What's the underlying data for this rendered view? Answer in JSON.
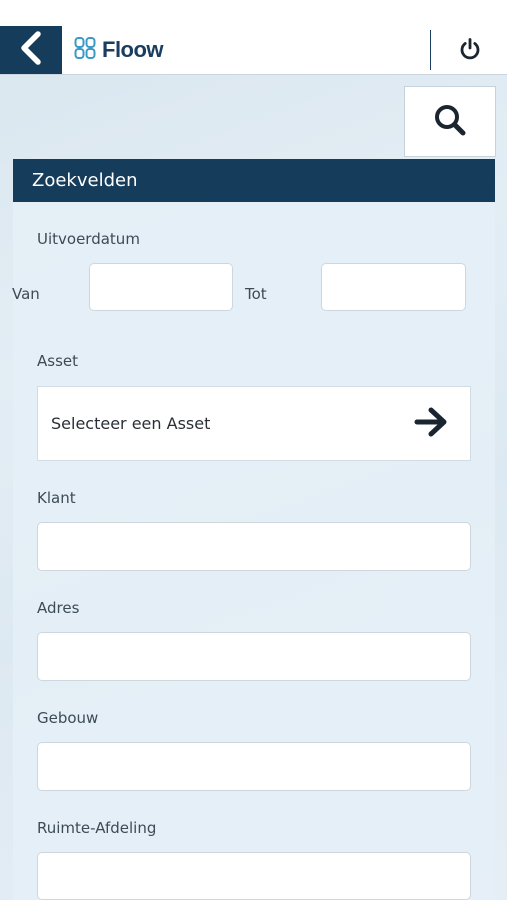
{
  "header": {
    "back_icon": "chevron-left-icon",
    "logo_text": "Floow",
    "power_icon": "power-icon",
    "brand_color": "#163c5c"
  },
  "search_button": {
    "icon": "search-icon"
  },
  "panel": {
    "title": "Zoekvelden",
    "uitvoerdatum_label": "Uitvoerdatum",
    "van_label": "Van",
    "van_value": "",
    "tot_label": "Tot",
    "tot_value": "",
    "asset_label": "Asset",
    "asset_select_text": "Selecteer een Asset",
    "asset_arrow_icon": "arrow-right-icon",
    "klant_label": "Klant",
    "klant_value": "",
    "adres_label": "Adres",
    "adres_value": "",
    "gebouw_label": "Gebouw",
    "gebouw_value": "",
    "ruimte_label": "Ruimte-Afdeling",
    "ruimte_value": ""
  }
}
